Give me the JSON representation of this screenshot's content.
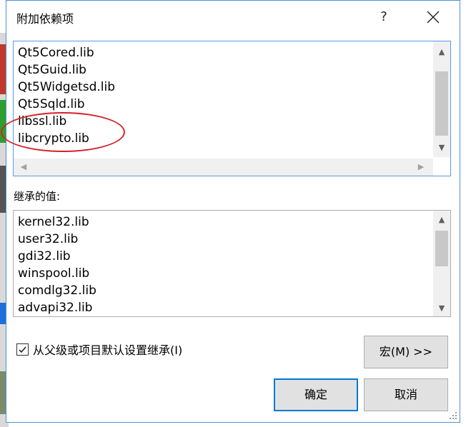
{
  "dialog": {
    "title": "附加依赖项",
    "help_label": "?",
    "close_icon": "close-icon"
  },
  "additional_deps": {
    "items": [
      "Qt5Cored.lib",
      "Qt5Guid.lib",
      "Qt5Widgetsd.lib",
      "Qt5Sqld.lib",
      "libssl.lib",
      "libcrypto.lib"
    ],
    "highlight_color": "#d4202a"
  },
  "inherited": {
    "label": "继承的值:",
    "items": [
      "kernel32.lib",
      "user32.lib",
      "gdi32.lib",
      "winspool.lib",
      "comdlg32.lib",
      "advapi32.lib"
    ]
  },
  "inherit_checkbox": {
    "label": "从父级或项目默认设置继承(I)",
    "checked": true
  },
  "buttons": {
    "macro": "宏(M) >>",
    "ok": "确定",
    "cancel": "取消"
  },
  "colors": {
    "accent": "#0078d7",
    "focus_border": "#569de5"
  }
}
